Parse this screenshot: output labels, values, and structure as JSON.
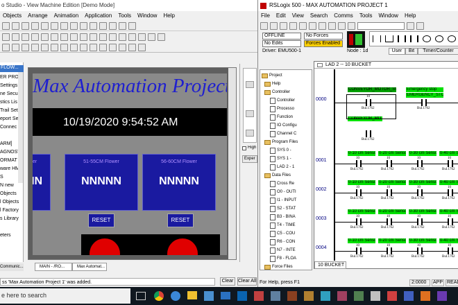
{
  "left": {
    "title": "o Studio - View Machine Edition [Demo Mode]",
    "menu": [
      "Objects",
      "Arrange",
      "Animation",
      "Application",
      "Tools",
      "Window",
      "Help"
    ],
    "explorer_items": [
      "ER PROJ",
      "Settings",
      "ne Securi",
      "stics Lis",
      "Trail Setu",
      "eport Sett",
      "Connec",
      "",
      "ARM]",
      "AGNOSTI",
      "ORMAT",
      "ware HM",
      "S",
      "N new",
      "Objects",
      "l Objects",
      "l Factory",
      "s Library",
      "",
      "eters"
    ],
    "side_dropdown": "FLOW...",
    "display": {
      "title": "Max Automation Project",
      "datetime": "10/19/2020 9:54:52 AM",
      "tiles": [
        {
          "label": "ower",
          "value": "NN"
        },
        {
          "label": "51-55CM Flower",
          "value": "NNNNN"
        },
        {
          "label": "56-60CM Flower",
          "value": "NNNNN"
        }
      ],
      "reset_label": "RESET"
    },
    "right_panel": {
      "high_label": "High",
      "expand_label": "Exper"
    },
    "tabs": [
      "MAIN - /RO...",
      "Max Automat..."
    ],
    "communic_tab": "Communic...",
    "diag_message": "ss 'Max Automation Project 1' was added.",
    "clear_label": "Clear",
    "clear_all_label": "Clear All"
  },
  "right": {
    "title": "RSLogix 500 - MAX AUTOMATION PROJECT 1",
    "menu": [
      "File",
      "Edit",
      "View",
      "Search",
      "Comms",
      "Tools",
      "Window",
      "Help"
    ],
    "status": {
      "mode": "OFFLINE",
      "edits": "No Edits",
      "forces": "No Forces",
      "forces_enabled": "Forces Enabled",
      "driver": "Driver: EMU500-1",
      "node": "Node : 1d"
    },
    "instr_tabs": [
      "User",
      "Bit",
      "Timer/Counter"
    ],
    "tree": [
      {
        "text": "Project",
        "type": "root"
      },
      {
        "text": "Help",
        "type": "folder"
      },
      {
        "text": "Controller",
        "type": "folder"
      },
      {
        "text": "Controller",
        "type": "doc"
      },
      {
        "text": "Processo",
        "type": "doc"
      },
      {
        "text": "Function",
        "type": "doc"
      },
      {
        "text": "IO Configu",
        "type": "doc"
      },
      {
        "text": "Channel C",
        "type": "doc"
      },
      {
        "text": "Program Files",
        "type": "folder"
      },
      {
        "text": "SYS 0 -",
        "type": "doc"
      },
      {
        "text": "SYS 1 -",
        "type": "doc"
      },
      {
        "text": "LAD 2 - 1",
        "type": "doc"
      },
      {
        "text": "Data Files",
        "type": "folder"
      },
      {
        "text": "Cross Re",
        "type": "doc"
      },
      {
        "text": "O0 - OUTI",
        "type": "doc"
      },
      {
        "text": "I1 - INPUT",
        "type": "doc"
      },
      {
        "text": "S2 - STAT",
        "type": "doc"
      },
      {
        "text": "B3 - BINA",
        "type": "doc"
      },
      {
        "text": "T4 - TIME",
        "type": "doc"
      },
      {
        "text": "C5 - COU",
        "type": "doc"
      },
      {
        "text": "R6 - CON",
        "type": "doc"
      },
      {
        "text": "N7 - INTE",
        "type": "doc"
      },
      {
        "text": "F8 - FLOA",
        "type": "doc"
      },
      {
        "text": "Force Files",
        "type": "folder"
      },
      {
        "text": "O0 - OUTI",
        "type": "doc"
      },
      {
        "text": "I1 - INPUT",
        "type": "doc"
      },
      {
        "text": "Custom Data",
        "type": "folder"
      },
      {
        "text": "CDM 0 - L",
        "type": "doc"
      }
    ],
    "ladder": {
      "title": "LAD 2 -- 10 BUCKET",
      "tab": "10 BUCKET",
      "rungs": [
        "0000",
        "0001",
        "0002",
        "0003",
        "0004"
      ],
      "rung0_labels": [
        "CONVEYOR_MOTOR_SW",
        "Emergency stop",
        "CONVEYOR_MOTOR",
        "EMERGENCY_STOP"
      ],
      "sensor_labels": [
        "0-10 cm Sensor",
        "0-20 cm Sensor",
        "0-30 cm Sensor",
        "0-40 cm Sensor"
      ],
      "contact_num": "10",
      "contact_addr": "Bul.1762",
      "contact_bit": "0"
    },
    "help_text": "For Help, press F1",
    "address": "2:0000",
    "app": "APP",
    "read": "READ"
  },
  "taskbar": {
    "search_placeholder": "e here to search"
  }
}
